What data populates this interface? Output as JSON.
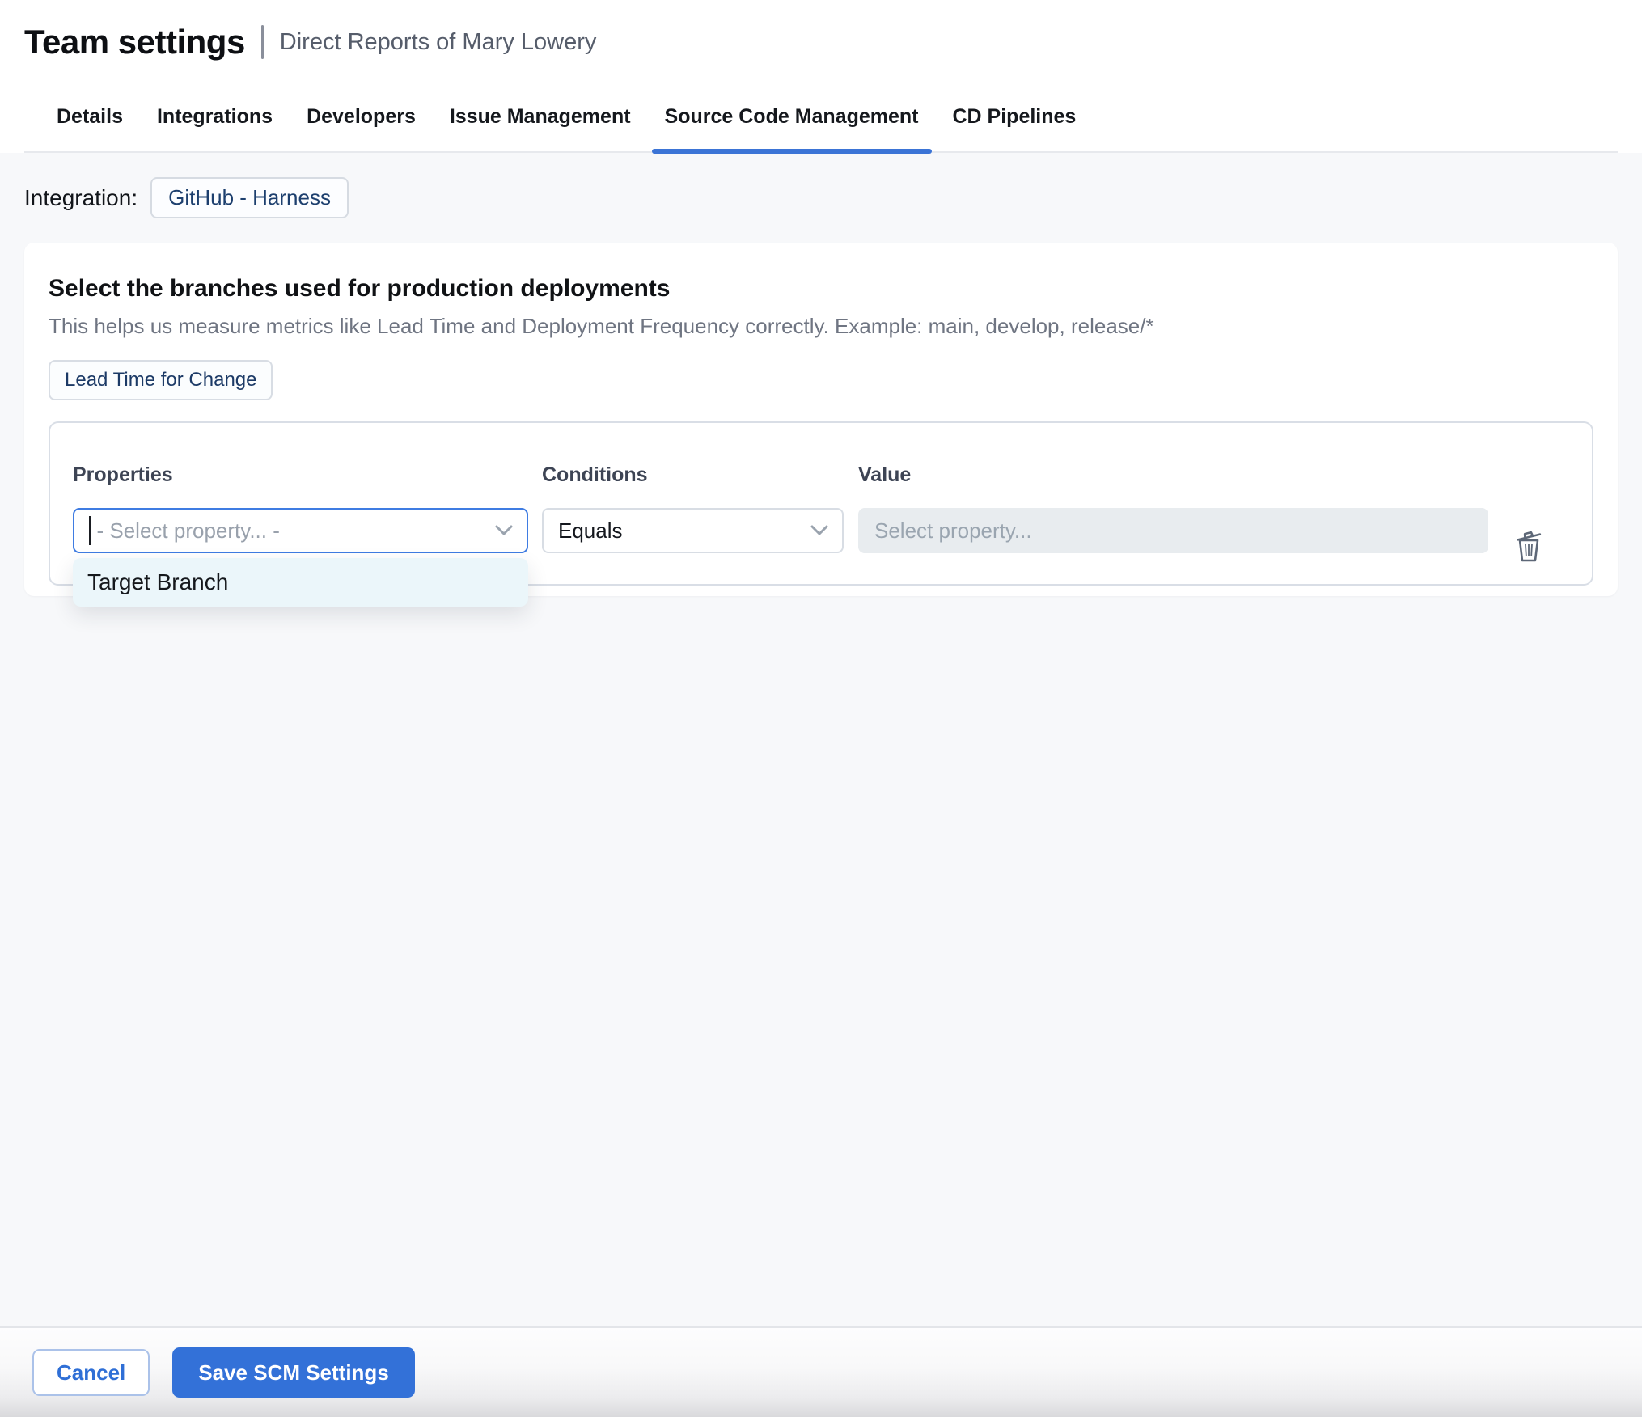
{
  "header": {
    "title": "Team settings",
    "subtitle": "Direct Reports of Mary Lowery"
  },
  "tabs": [
    {
      "label": "Details",
      "active": false
    },
    {
      "label": "Integrations",
      "active": false
    },
    {
      "label": "Developers",
      "active": false
    },
    {
      "label": "Issue Management",
      "active": false
    },
    {
      "label": "Source Code Management",
      "active": true
    },
    {
      "label": "CD Pipelines",
      "active": false
    }
  ],
  "integration": {
    "label": "Integration:",
    "chip": "GitHub - Harness"
  },
  "card": {
    "title": "Select the branches used for production deployments",
    "subtitle": "This helps us measure metrics like Lead Time and Deployment Frequency correctly. Example: main, develop, release/*",
    "metric_chip": "Lead Time for Change",
    "rule": {
      "properties_label": "Properties",
      "conditions_label": "Conditions",
      "value_label": "Value",
      "property_placeholder": "- Select property... -",
      "condition_value": "Equals",
      "value_placeholder": "Select property...",
      "dropdown_options": [
        "Target Branch"
      ]
    }
  },
  "footer": {
    "cancel_label": "Cancel",
    "save_label": "Save SCM Settings"
  },
  "colors": {
    "accent_blue": "#3371d8",
    "tab_underline": "#3b74d6",
    "focus_border": "#3f7ce2",
    "chip_text": "#1d3f6e",
    "disabled_input_bg": "#e8ecef",
    "dropdown_bg": "#ebf6fa"
  }
}
